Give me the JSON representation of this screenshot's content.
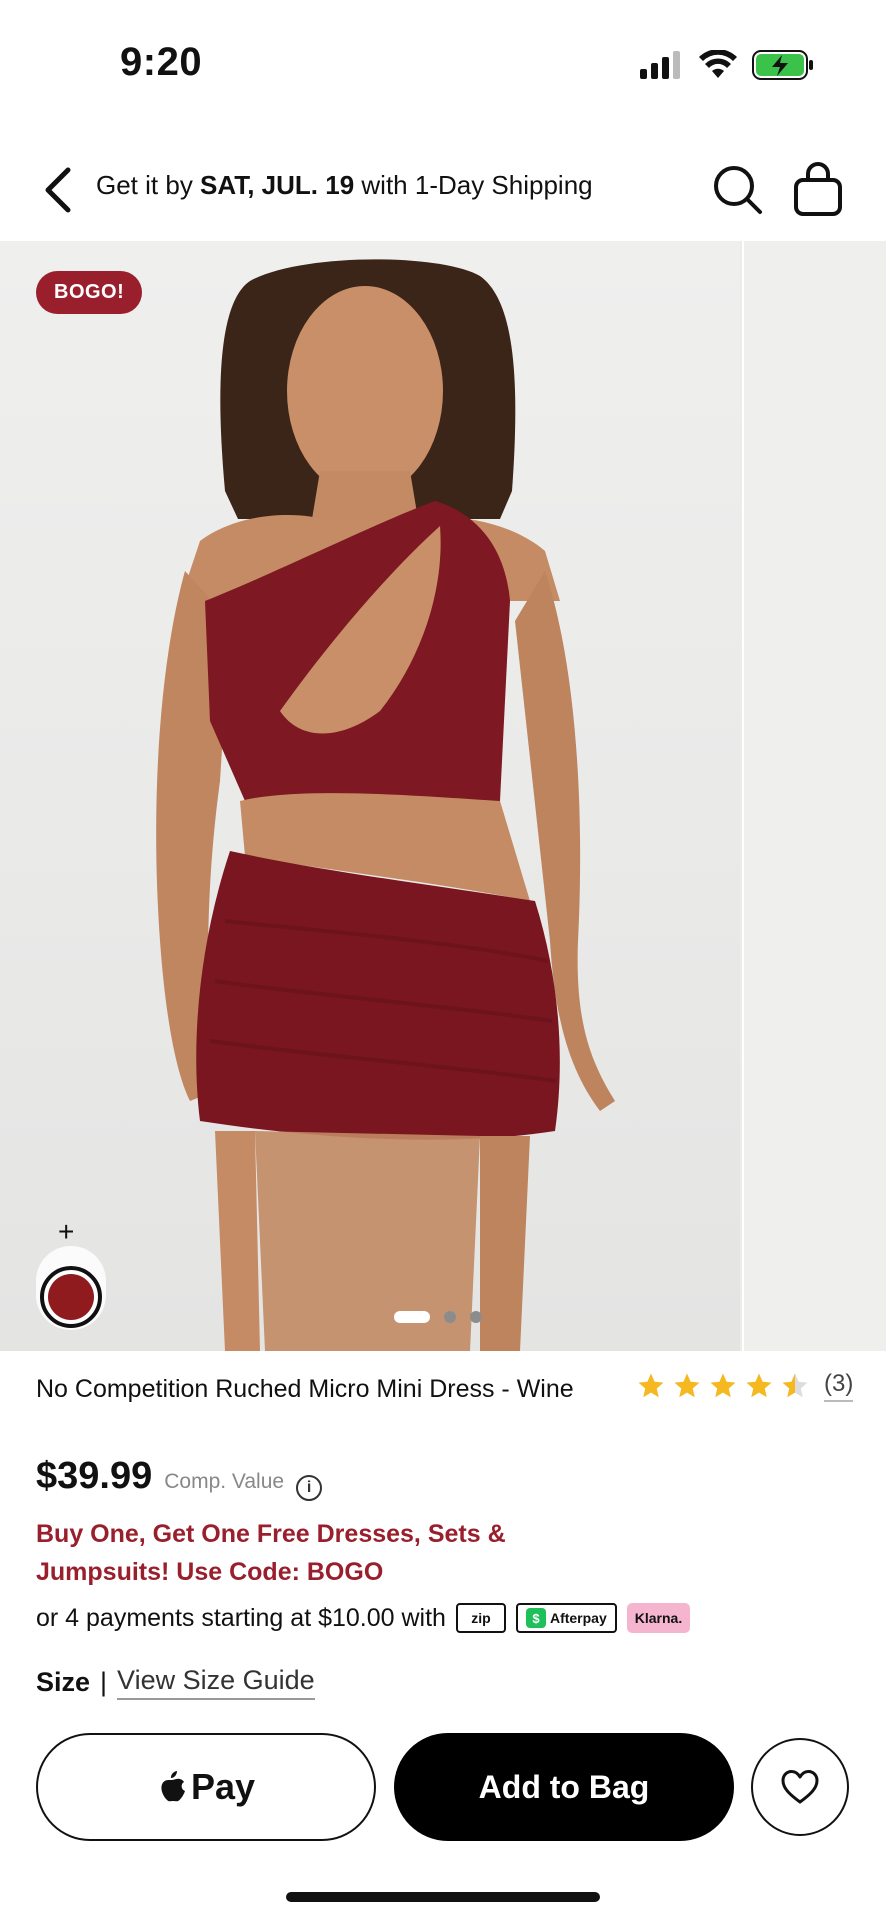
{
  "status_bar": {
    "time": "9:20",
    "icons": [
      "signal-icon",
      "wifi-icon",
      "battery-charging-icon"
    ]
  },
  "header": {
    "back_icon": "chevron-left-icon",
    "shipping_prefix": "Get it by ",
    "shipping_date": "SAT, JUL. 19",
    "shipping_suffix": " with 1-Day Shipping",
    "search_icon": "search-icon",
    "bag_icon": "shopping-bag-icon"
  },
  "gallery": {
    "badge": "BOGO!",
    "swatch_add": "+",
    "swatch_color": "#8f1b1f",
    "current_slide": 1,
    "total_slides": 3,
    "share_icon": "share-icon"
  },
  "product": {
    "title": "No Competition Ruched Micro Mini Dress - Wine",
    "rating": 4.5,
    "rating_count": "(3)",
    "price": "$39.99",
    "comp_value": "Comp. Value",
    "promo": "Buy One, Get One Free Dresses, Sets & Jumpsuits! Use Code: BOGO",
    "payments_text": "or 4 payments starting at $10.00 with",
    "payment_logos": {
      "zip": "zip",
      "afterpay": "Afterpay",
      "klarna": "Klarna."
    },
    "size_label": "Size",
    "size_separator": "|",
    "size_guide": "View Size Guide"
  },
  "actions": {
    "apple_pay": "Pay",
    "add_to_bag": "Add to Bag",
    "wishlist_icon": "heart-icon"
  },
  "colors": {
    "brand_red": "#9a1f2c",
    "star": "#f5b820",
    "black": "#000000"
  }
}
